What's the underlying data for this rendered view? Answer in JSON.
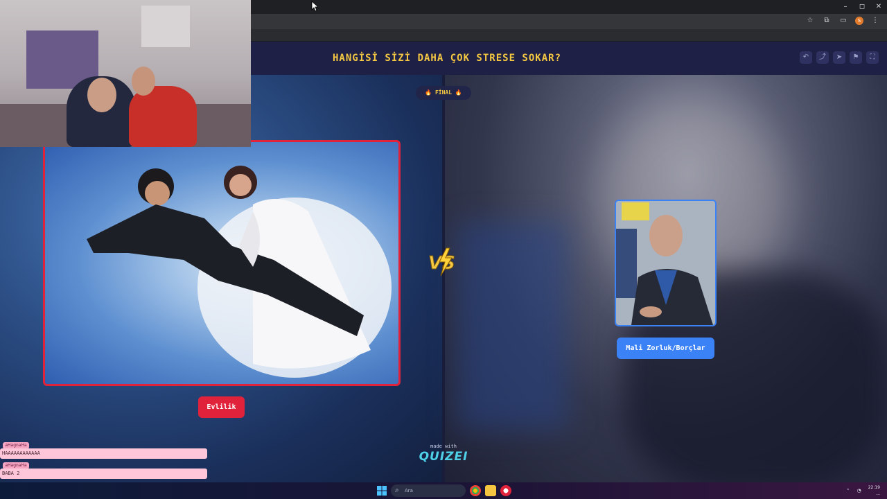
{
  "browser": {
    "window_controls": {
      "minimize": "–",
      "maximize": "◻",
      "close": "✕"
    },
    "toolbar_icons": [
      "star-icon",
      "extensions-icon",
      "cast-icon",
      "profile-icon",
      "menu-icon"
    ]
  },
  "quiz": {
    "question": "HANGİSİ SİZİ DAHA ÇOK STRESE SOKAR?",
    "round_badge": "🔥 FİNAL 🔥",
    "option_left": {
      "label": "Evlilik",
      "accent": "#e0223b"
    },
    "option_right": {
      "label": "Mali Zorluk/Borçlar",
      "accent": "#3b82f6"
    },
    "footer_small": "made with",
    "footer_brand": "QUIZEI",
    "header_actions": [
      "undo-icon",
      "share-icon",
      "send-icon",
      "flag-icon",
      "fullscreen-icon"
    ]
  },
  "chat": {
    "messages": [
      {
        "user": "aHagnaHa",
        "text": "HAAAAAAAAAAAA"
      },
      {
        "user": "aHagnaHa",
        "text": "BABA 2"
      }
    ]
  },
  "taskbar": {
    "search_placeholder": "Ara",
    "time": "22:19",
    "date": "..."
  },
  "colors": {
    "question_yellow": "#f5c842",
    "topbar_navy": "#1e2046",
    "left_red": "#e0223b",
    "right_blue": "#3b82f6"
  }
}
